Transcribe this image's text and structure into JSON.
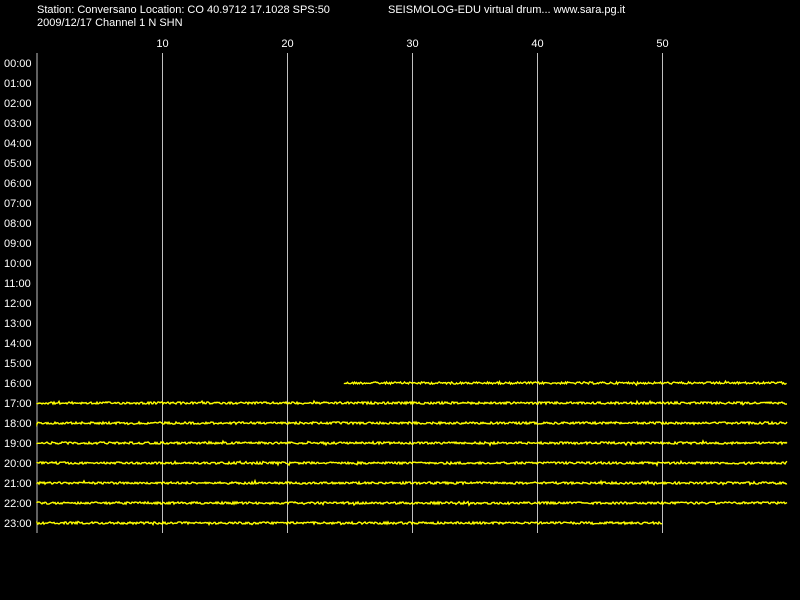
{
  "header": {
    "station_line": "Station: Conversano Location: CO 40.9712 17.1028 SPS:50",
    "date_line": "2009/12/17  Channel 1 N SHN",
    "title": "SEISMOLOG-EDU virtual drum... www.sara.pg.it"
  },
  "colors": {
    "background": "#000000",
    "text": "#ffffff",
    "grid": "#c0c0c0",
    "trace": "#ffff00"
  },
  "chart_data": {
    "type": "line",
    "x_unit": "minutes",
    "xlim": [
      0,
      60
    ],
    "x_ticks": [
      10,
      20,
      30,
      40,
      50
    ],
    "grid": "vertical",
    "rows": [
      {
        "label": "00:00",
        "trace": null
      },
      {
        "label": "01:00",
        "trace": null
      },
      {
        "label": "02:00",
        "trace": null
      },
      {
        "label": "03:00",
        "trace": null
      },
      {
        "label": "04:00",
        "trace": null
      },
      {
        "label": "05:00",
        "trace": null
      },
      {
        "label": "06:00",
        "trace": null
      },
      {
        "label": "07:00",
        "trace": null
      },
      {
        "label": "08:00",
        "trace": null
      },
      {
        "label": "09:00",
        "trace": null
      },
      {
        "label": "10:00",
        "trace": null
      },
      {
        "label": "11:00",
        "trace": null
      },
      {
        "label": "12:00",
        "trace": null
      },
      {
        "label": "13:00",
        "trace": null
      },
      {
        "label": "14:00",
        "trace": null
      },
      {
        "label": "15:00",
        "trace": null
      },
      {
        "label": "16:00",
        "trace": [
          24.6,
          60
        ]
      },
      {
        "label": "17:00",
        "trace": [
          0,
          60
        ]
      },
      {
        "label": "18:00",
        "trace": [
          0,
          60
        ]
      },
      {
        "label": "19:00",
        "trace": [
          0,
          60
        ]
      },
      {
        "label": "20:00",
        "trace": [
          0,
          60
        ]
      },
      {
        "label": "21:00",
        "trace": [
          0,
          60
        ]
      },
      {
        "label": "22:00",
        "trace": [
          0,
          60
        ]
      },
      {
        "label": "23:00",
        "trace": [
          0,
          50
        ]
      }
    ]
  }
}
